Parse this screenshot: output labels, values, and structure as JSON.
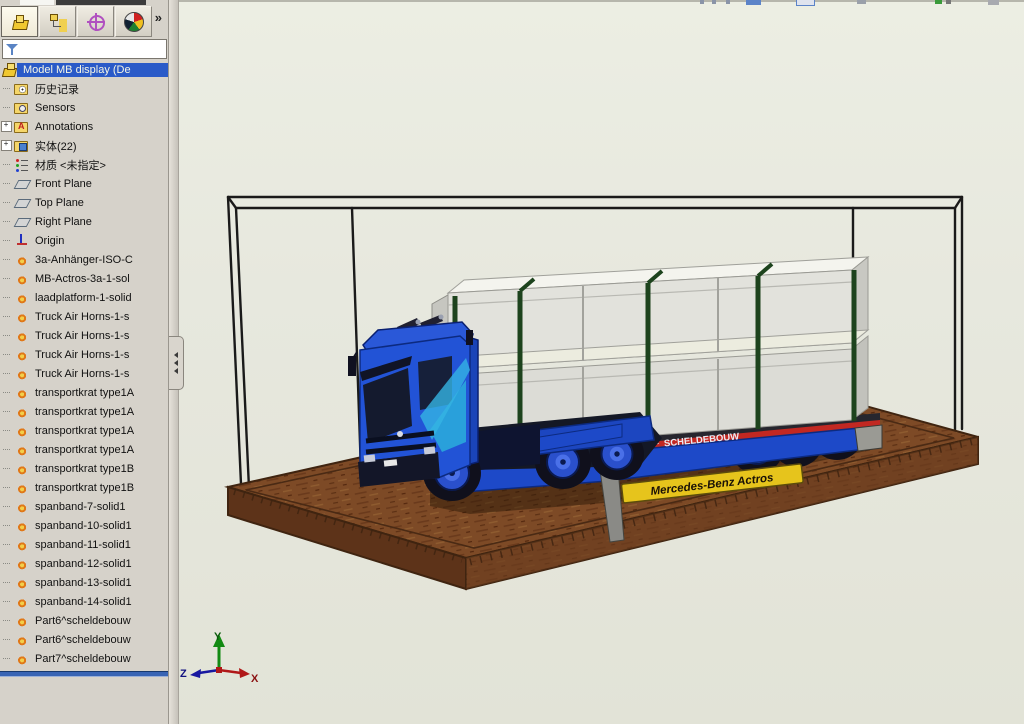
{
  "panel": {
    "tabs": [
      {
        "icon": "featuremanager-tree-icon",
        "active": true
      },
      {
        "icon": "property-manager-icon",
        "active": false
      },
      {
        "icon": "configuration-manager-icon",
        "active": false
      },
      {
        "icon": "display-manager-icon",
        "active": false
      }
    ],
    "overflow_chevron": "»",
    "filter": {
      "value": "",
      "placeholder": ""
    },
    "tree": [
      {
        "label": "Model MB display  (De",
        "icon": "assembly",
        "selected": true,
        "root": true
      },
      {
        "label": "历史记录",
        "icon": "history"
      },
      {
        "label": "Sensors",
        "icon": "sensors"
      },
      {
        "label": "Annotations",
        "icon": "annotations",
        "expander": "+"
      },
      {
        "label": "实体(22)",
        "icon": "solids",
        "expander": "+"
      },
      {
        "label": "材质 <未指定>",
        "icon": "material"
      },
      {
        "label": "Front Plane",
        "icon": "plane"
      },
      {
        "label": "Top Plane",
        "icon": "plane"
      },
      {
        "label": "Right Plane",
        "icon": "plane"
      },
      {
        "label": "Origin",
        "icon": "origin"
      },
      {
        "label": "3a-Anhänger-ISO-C",
        "icon": "body"
      },
      {
        "label": "MB-Actros-3a-1-sol",
        "icon": "body"
      },
      {
        "label": "laadplatform-1-solid",
        "icon": "body"
      },
      {
        "label": "Truck Air Horns-1-s",
        "icon": "body"
      },
      {
        "label": "Truck Air Horns-1-s",
        "icon": "body"
      },
      {
        "label": "Truck Air Horns-1-s",
        "icon": "body"
      },
      {
        "label": "Truck Air Horns-1-s",
        "icon": "body"
      },
      {
        "label": "transportkrat type1A",
        "icon": "body"
      },
      {
        "label": "transportkrat type1A",
        "icon": "body"
      },
      {
        "label": "transportkrat type1A",
        "icon": "body"
      },
      {
        "label": "transportkrat type1A",
        "icon": "body"
      },
      {
        "label": "transportkrat type1B",
        "icon": "body"
      },
      {
        "label": "transportkrat type1B",
        "icon": "body"
      },
      {
        "label": "spanband-7-solid1",
        "icon": "body"
      },
      {
        "label": "spanband-10-solid1",
        "icon": "body"
      },
      {
        "label": "spanband-11-solid1",
        "icon": "body"
      },
      {
        "label": "spanband-12-solid1",
        "icon": "body"
      },
      {
        "label": "spanband-13-solid1",
        "icon": "body"
      },
      {
        "label": "spanband-14-solid1",
        "icon": "body"
      },
      {
        "label": "Part6^scheldebouw",
        "icon": "body"
      },
      {
        "label": "Part6^scheldebouw",
        "icon": "body"
      },
      {
        "label": "Part7^scheldebouw",
        "icon": "body"
      }
    ]
  },
  "viewport": {
    "nameplate_text": "Mercedes-Benz Actros",
    "trailer_side_text": "SCHELDEBOUW",
    "triad": {
      "x_label": "X",
      "y_label": "Y",
      "z_label": "Z"
    },
    "colors": {
      "truck_blue": "#2253d6",
      "container_gray": "#e2e2dc",
      "strap_green": "#1d431d",
      "base_brown": "#7d4a26",
      "nameplate_yellow": "#e6c41c",
      "case_line": "#1a1a1a"
    }
  }
}
